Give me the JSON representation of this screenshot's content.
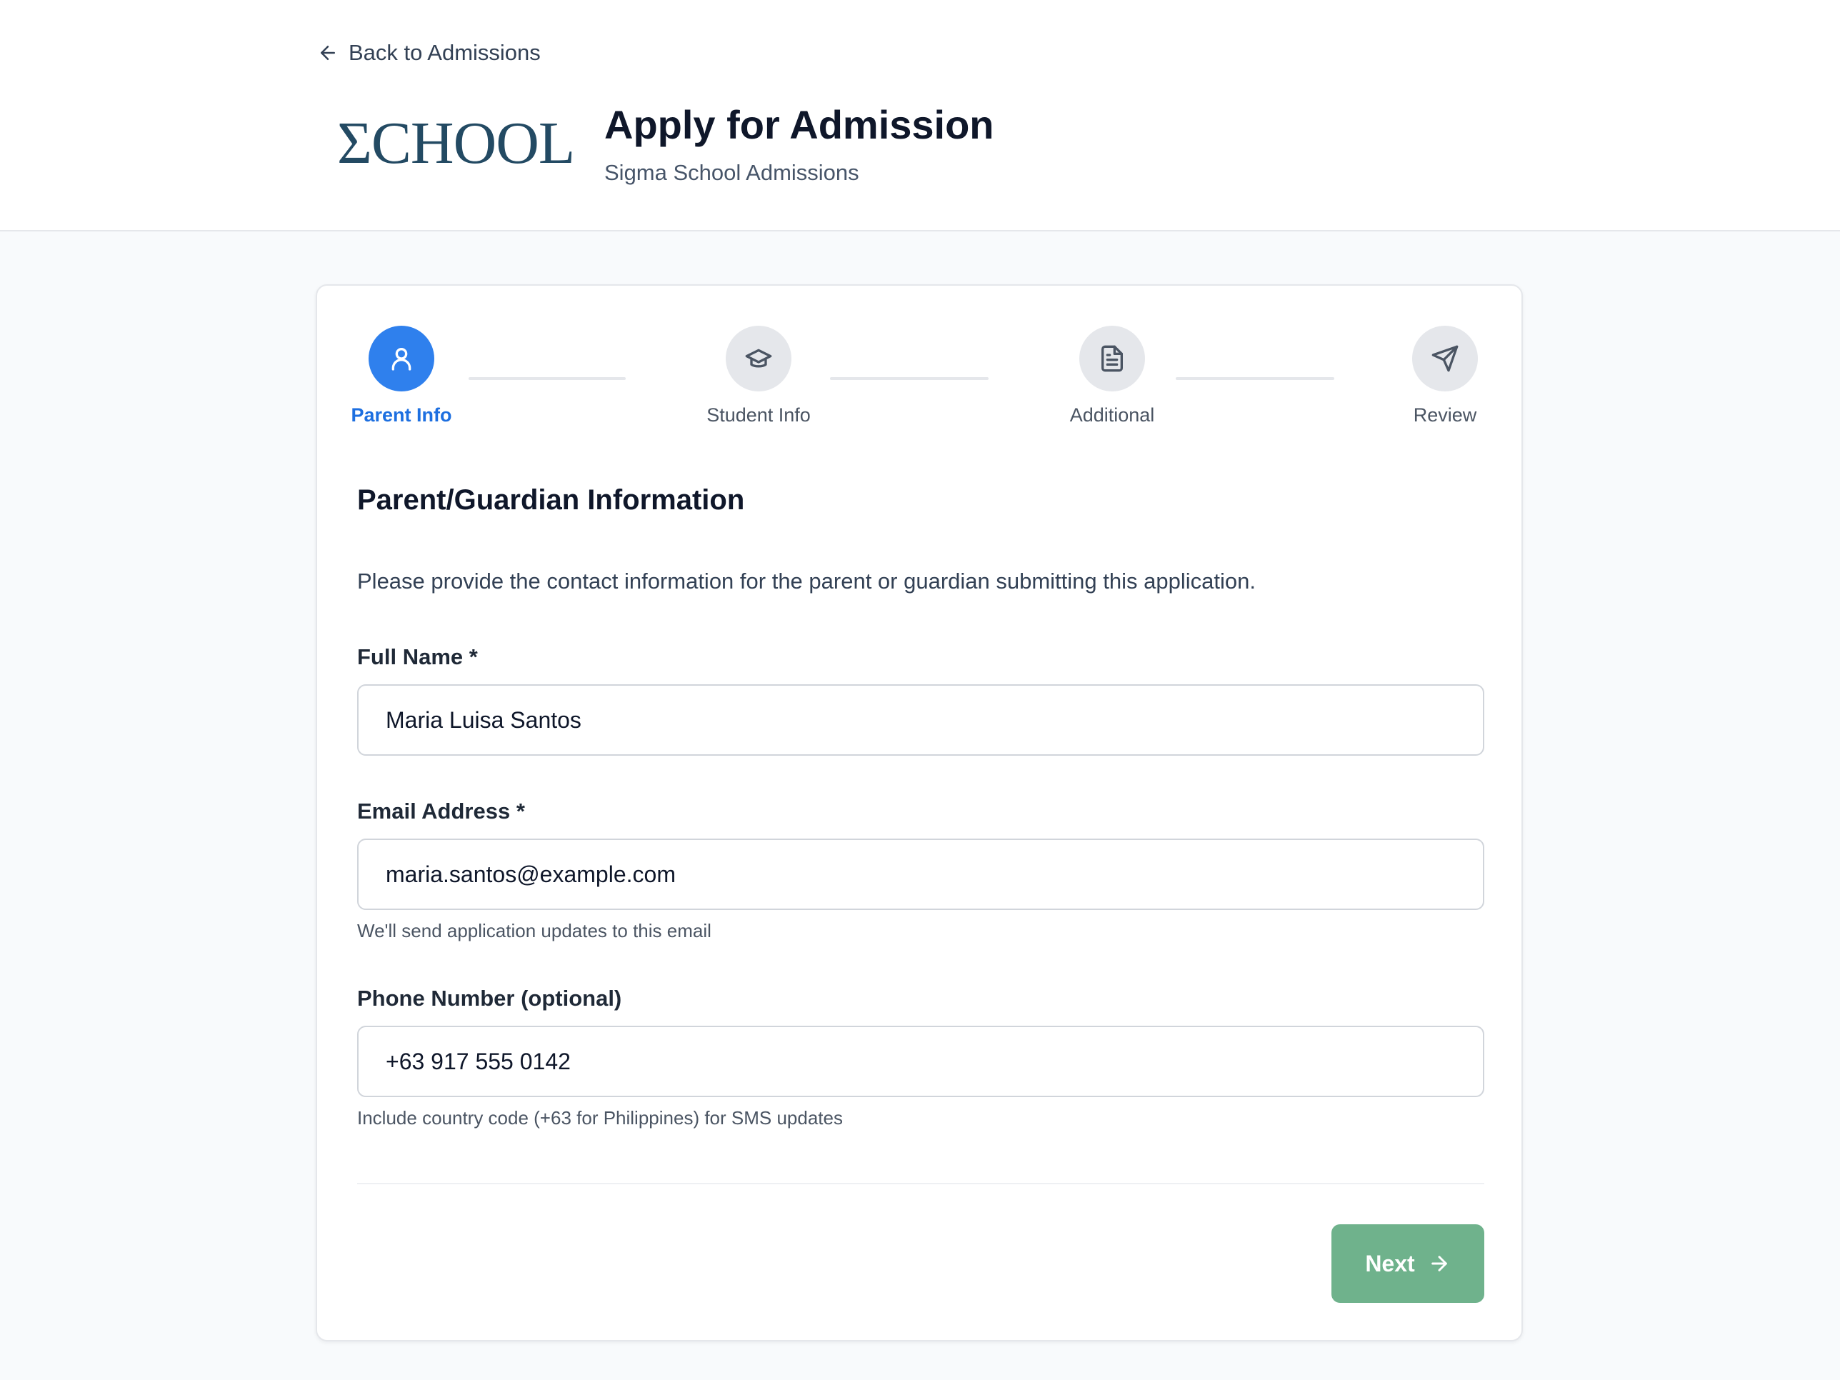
{
  "header": {
    "back_link": "Back to Admissions",
    "logo_text": "ΣCHOOL",
    "title": "Apply for Admission",
    "subtitle": "Sigma School Admissions"
  },
  "stepper": {
    "steps": [
      {
        "label": "Parent Info",
        "icon": "user-icon",
        "state": "active"
      },
      {
        "label": "Student Info",
        "icon": "graduation-cap-icon",
        "state": "pending"
      },
      {
        "label": "Additional",
        "icon": "document-icon",
        "state": "pending"
      },
      {
        "label": "Review",
        "icon": "send-icon",
        "state": "pending"
      }
    ]
  },
  "form": {
    "section_title": "Parent/Guardian Information",
    "section_description": "Please provide the contact information for the parent or guardian submitting this application.",
    "full_name": {
      "label": "Full Name *",
      "value": "Maria Luisa Santos"
    },
    "email": {
      "label": "Email Address *",
      "value": "maria.santos@example.com",
      "help": "We'll send application updates to this email"
    },
    "phone": {
      "label": "Phone Number (optional)",
      "value": "+63 917 555 0142",
      "help": "Include country code (+63 for Philippines) for SMS updates"
    },
    "next_label": "Next"
  },
  "colors": {
    "accent": "#2f80ed",
    "next_button": "#6fb28c",
    "logo": "#234a63"
  }
}
